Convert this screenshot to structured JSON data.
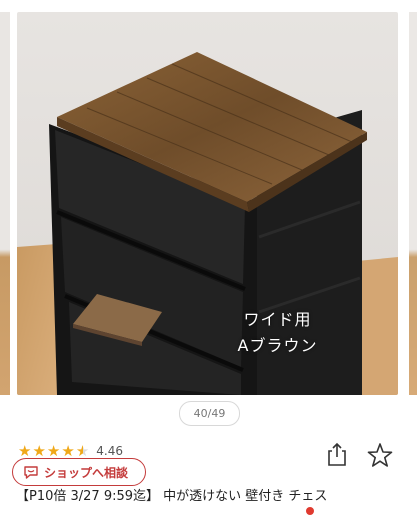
{
  "gallery": {
    "caption_line1": "ワイド用",
    "caption_line2": "Aブラウン",
    "counter": "40/49"
  },
  "product": {
    "rating_value": "4.46",
    "stars_full": 4,
    "stars_half": 1,
    "title": "【P10倍 3/27 9:59迄】 中が透けない 壁付き チェス"
  },
  "actions": {
    "shop_consult_label": "ショップへ相談",
    "share_icon": "share-icon",
    "favorite_icon": "star-outline-icon"
  },
  "colors": {
    "accent_red": "#c43b3b",
    "star_gold": "#f0a818"
  }
}
